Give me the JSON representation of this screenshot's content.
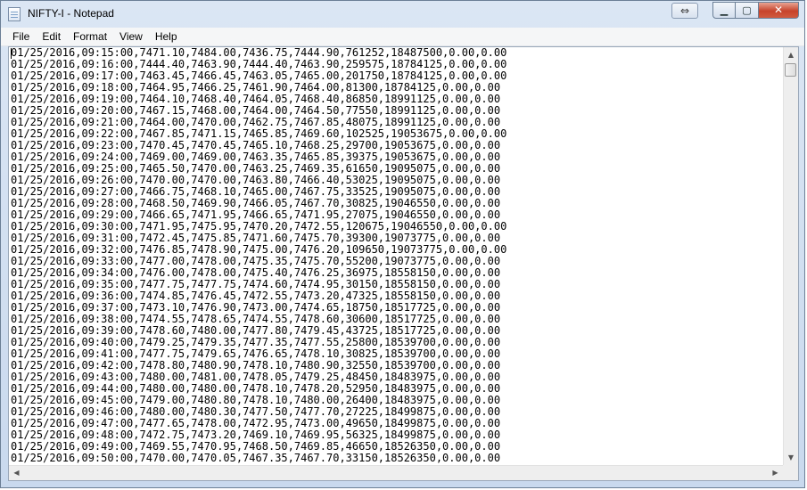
{
  "window": {
    "title": "NIFTY-I - Notepad",
    "icons": {
      "app": "notepad-icon",
      "restore_tab": "double-arrow-icon",
      "minimize": "minimize-icon",
      "maximize": "maximize-icon",
      "close": "close-icon"
    }
  },
  "menu": {
    "items": [
      {
        "label": "File"
      },
      {
        "label": "Edit"
      },
      {
        "label": "Format"
      },
      {
        "label": "View"
      },
      {
        "label": "Help"
      }
    ]
  },
  "content": {
    "lines": [
      "01/25/2016,09:15:00,7471.10,7484.00,7436.75,7444.90,761252,18487500,0.00,0.00",
      "01/25/2016,09:16:00,7444.40,7463.90,7444.40,7463.90,259575,18784125,0.00,0.00",
      "01/25/2016,09:17:00,7463.45,7466.45,7463.05,7465.00,201750,18784125,0.00,0.00",
      "01/25/2016,09:18:00,7464.95,7466.25,7461.90,7464.00,81300,18784125,0.00,0.00",
      "01/25/2016,09:19:00,7464.10,7468.40,7464.05,7468.40,86850,18991125,0.00,0.00",
      "01/25/2016,09:20:00,7467.15,7468.00,7464.00,7464.50,77550,18991125,0.00,0.00",
      "01/25/2016,09:21:00,7464.00,7470.00,7462.75,7467.85,48075,18991125,0.00,0.00",
      "01/25/2016,09:22:00,7467.85,7471.15,7465.85,7469.60,102525,19053675,0.00,0.00",
      "01/25/2016,09:23:00,7470.45,7470.45,7465.10,7468.25,29700,19053675,0.00,0.00",
      "01/25/2016,09:24:00,7469.00,7469.00,7463.35,7465.85,39375,19053675,0.00,0.00",
      "01/25/2016,09:25:00,7465.50,7470.00,7463.25,7469.35,61650,19095075,0.00,0.00",
      "01/25/2016,09:26:00,7470.00,7470.00,7463.80,7466.40,53025,19095075,0.00,0.00",
      "01/25/2016,09:27:00,7466.75,7468.10,7465.00,7467.75,33525,19095075,0.00,0.00",
      "01/25/2016,09:28:00,7468.50,7469.90,7466.05,7467.70,30825,19046550,0.00,0.00",
      "01/25/2016,09:29:00,7466.65,7471.95,7466.65,7471.95,27075,19046550,0.00,0.00",
      "01/25/2016,09:30:00,7471.95,7475.95,7470.20,7472.55,120675,19046550,0.00,0.00",
      "01/25/2016,09:31:00,7472.45,7475.85,7471.60,7475.70,39300,19073775,0.00,0.00",
      "01/25/2016,09:32:00,7476.85,7478.90,7475.00,7476.20,109650,19073775,0.00,0.00",
      "01/25/2016,09:33:00,7477.00,7478.00,7475.35,7475.70,55200,19073775,0.00,0.00",
      "01/25/2016,09:34:00,7476.00,7478.00,7475.40,7476.25,36975,18558150,0.00,0.00",
      "01/25/2016,09:35:00,7477.75,7477.75,7474.60,7474.95,30150,18558150,0.00,0.00",
      "01/25/2016,09:36:00,7474.85,7476.45,7472.55,7473.20,47325,18558150,0.00,0.00",
      "01/25/2016,09:37:00,7473.10,7476.90,7473.00,7474.65,18750,18517725,0.00,0.00",
      "01/25/2016,09:38:00,7474.55,7478.65,7474.55,7478.60,30600,18517725,0.00,0.00",
      "01/25/2016,09:39:00,7478.60,7480.00,7477.80,7479.45,43725,18517725,0.00,0.00",
      "01/25/2016,09:40:00,7479.25,7479.35,7477.35,7477.55,25800,18539700,0.00,0.00",
      "01/25/2016,09:41:00,7477.75,7479.65,7476.65,7478.10,30825,18539700,0.00,0.00",
      "01/25/2016,09:42:00,7478.80,7480.90,7478.10,7480.90,32550,18539700,0.00,0.00",
      "01/25/2016,09:43:00,7480.00,7481.00,7478.05,7479.25,48450,18483975,0.00,0.00",
      "01/25/2016,09:44:00,7480.00,7480.00,7478.10,7478.20,52950,18483975,0.00,0.00",
      "01/25/2016,09:45:00,7479.00,7480.80,7478.10,7480.00,26400,18483975,0.00,0.00",
      "01/25/2016,09:46:00,7480.00,7480.30,7477.50,7477.70,27225,18499875,0.00,0.00",
      "01/25/2016,09:47:00,7477.65,7478.00,7472.95,7473.00,49650,18499875,0.00,0.00",
      "01/25/2016,09:48:00,7472.75,7473.20,7469.10,7469.95,56325,18499875,0.00,0.00",
      "01/25/2016,09:49:00,7469.55,7470.95,7468.50,7469.85,46650,18526350,0.00,0.00",
      "01/25/2016,09:50:00,7470.00,7470.05,7467.35,7467.70,33150,18526350,0.00,0.00"
    ]
  },
  "scrollbars": {
    "vertical": {
      "up_glyph": "▲",
      "down_glyph": "▼"
    },
    "horizontal": {
      "left_glyph": "◀",
      "right_glyph": "▶"
    }
  }
}
